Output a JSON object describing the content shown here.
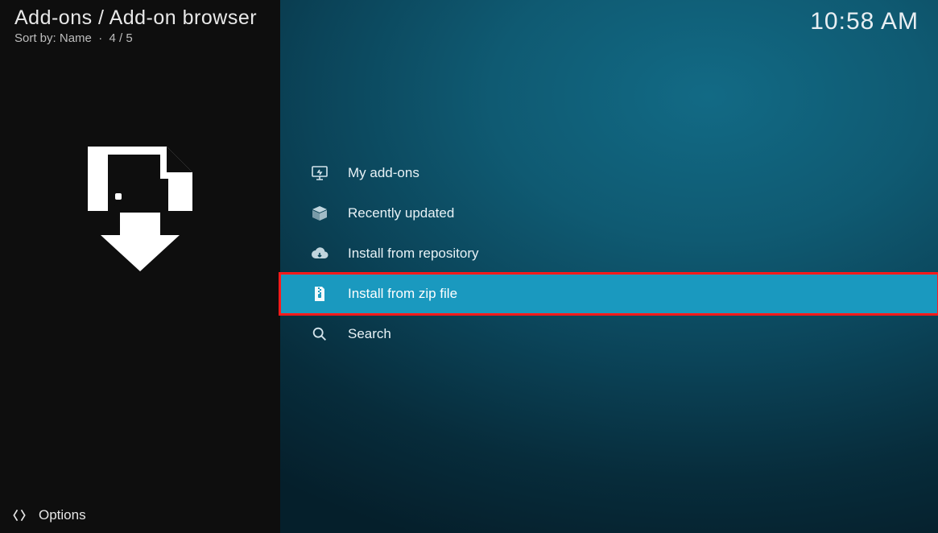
{
  "header": {
    "breadcrumb": "Add-ons / Add-on browser",
    "sort_prefix": "Sort by:",
    "sort_value": "Name",
    "position": "4 / 5"
  },
  "clock": "10:58 AM",
  "menu": {
    "items": [
      {
        "icon": "monitor-icon",
        "label": "My add-ons"
      },
      {
        "icon": "open-box-icon",
        "label": "Recently updated"
      },
      {
        "icon": "cloud-download-icon",
        "label": "Install from repository"
      },
      {
        "icon": "zip-file-icon",
        "label": "Install from zip file"
      },
      {
        "icon": "search-icon",
        "label": "Search"
      }
    ],
    "selected_index": 3
  },
  "options_label": "Options"
}
